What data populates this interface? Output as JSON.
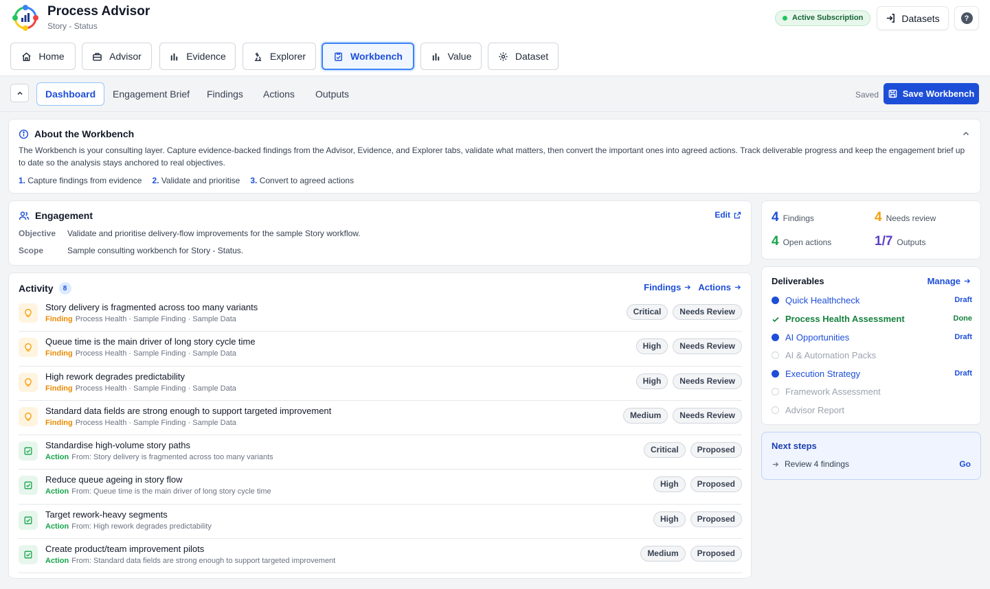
{
  "app": {
    "title": "Process Advisor",
    "subtitle": "Story - Status"
  },
  "header": {
    "subscription_label": "Active Subscription",
    "datasets_label": "Datasets",
    "help_label": "?"
  },
  "nav": {
    "tabs": [
      {
        "label": "Home",
        "icon": "home-icon"
      },
      {
        "label": "Advisor",
        "icon": "briefcase-icon"
      },
      {
        "label": "Evidence",
        "icon": "bar-chart-icon"
      },
      {
        "label": "Explorer",
        "icon": "microscope-icon"
      },
      {
        "label": "Workbench",
        "icon": "clipboard-check-icon",
        "active": true
      },
      {
        "label": "Value",
        "icon": "bar-chart-icon"
      },
      {
        "label": "Dataset",
        "icon": "gear-icon"
      }
    ]
  },
  "subnav": {
    "tabs": [
      "Dashboard",
      "Engagement Brief",
      "Findings",
      "Actions",
      "Outputs"
    ],
    "active": "Dashboard",
    "saved_label": "Saved",
    "save_button": "Save Workbench"
  },
  "about": {
    "title": "About the Workbench",
    "text": "The Workbench is your consulting layer. Capture evidence-backed findings from the Advisor, Evidence, and Explorer tabs, validate what matters, then convert the important ones into agreed actions. Track deliverable progress and keep the engagement brief up to date so the analysis stays anchored to real objectives.",
    "steps": [
      {
        "num": "1.",
        "text": "Capture findings from evidence"
      },
      {
        "num": "2.",
        "text": "Validate and prioritise"
      },
      {
        "num": "3.",
        "text": "Convert to agreed actions"
      }
    ]
  },
  "engagement": {
    "title": "Engagement",
    "edit_label": "Edit",
    "objective_label": "Objective",
    "objective": "Validate and prioritise delivery-flow improvements for the sample Story workflow.",
    "scope_label": "Scope",
    "scope": "Sample consulting workbench for Story - Status."
  },
  "activity": {
    "title": "Activity",
    "count": "8",
    "findings_link": "Findings",
    "actions_link": "Actions",
    "items": [
      {
        "type": "finding",
        "kind": "Finding",
        "title": "Story delivery is fragmented across too many variants",
        "meta": "Process Health · Sample Finding · Sample Data",
        "severity": "Critical",
        "status": "Needs Review"
      },
      {
        "type": "finding",
        "kind": "Finding",
        "title": "Queue time is the main driver of long story cycle time",
        "meta": "Process Health · Sample Finding · Sample Data",
        "severity": "High",
        "status": "Needs Review"
      },
      {
        "type": "finding",
        "kind": "Finding",
        "title": "High rework degrades predictability",
        "meta": "Process Health · Sample Finding · Sample Data",
        "severity": "High",
        "status": "Needs Review"
      },
      {
        "type": "finding",
        "kind": "Finding",
        "title": "Standard data fields are strong enough to support targeted improvement",
        "meta": "Process Health · Sample Finding · Sample Data",
        "severity": "Medium",
        "status": "Needs Review"
      },
      {
        "type": "action",
        "kind": "Action",
        "title": "Standardise high-volume story paths",
        "meta": "From: Story delivery is fragmented across too many variants",
        "severity": "Critical",
        "status": "Proposed"
      },
      {
        "type": "action",
        "kind": "Action",
        "title": "Reduce queue ageing in story flow",
        "meta": "From: Queue time is the main driver of long story cycle time",
        "severity": "High",
        "status": "Proposed"
      },
      {
        "type": "action",
        "kind": "Action",
        "title": "Target rework-heavy segments",
        "meta": "From: High rework degrades predictability",
        "severity": "High",
        "status": "Proposed"
      },
      {
        "type": "action",
        "kind": "Action",
        "title": "Create product/team improvement pilots",
        "meta": "From: Standard data fields are strong enough to support targeted improvement",
        "severity": "Medium",
        "status": "Proposed"
      }
    ]
  },
  "stats": {
    "findings": {
      "value": "4",
      "label": "Findings",
      "color": "#1d4ed8"
    },
    "needs_review": {
      "value": "4",
      "label": "Needs review",
      "color": "#f59e0b"
    },
    "open_actions": {
      "value": "4",
      "label": "Open actions",
      "color": "#16a34a"
    },
    "outputs": {
      "value": "1/7",
      "label": "Outputs",
      "color": "#5b3fc4"
    }
  },
  "deliverables": {
    "title": "Deliverables",
    "manage_label": "Manage",
    "items": [
      {
        "label": "Quick Healthcheck",
        "state": "draft",
        "status": "Draft"
      },
      {
        "label": "Process Health Assessment",
        "state": "done",
        "status": "Done"
      },
      {
        "label": "AI Opportunities",
        "state": "draft",
        "status": "Draft"
      },
      {
        "label": "AI & Automation Packs",
        "state": "empty",
        "status": ""
      },
      {
        "label": "Execution Strategy",
        "state": "draft",
        "status": "Draft"
      },
      {
        "label": "Framework Assessment",
        "state": "empty",
        "status": ""
      },
      {
        "label": "Advisor Report",
        "state": "empty",
        "status": ""
      }
    ]
  },
  "next_steps": {
    "title": "Next steps",
    "item": "Review 4 findings",
    "go_label": "Go"
  }
}
